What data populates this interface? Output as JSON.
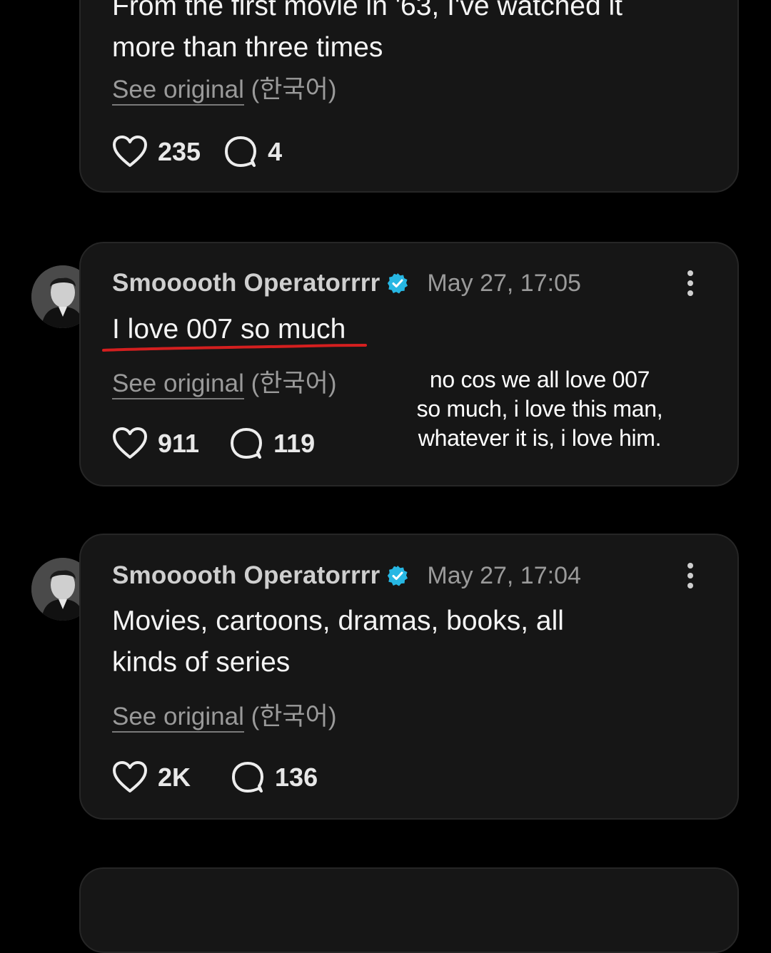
{
  "comments": [
    {
      "text_line_1": "From the first movie in '63, I've watched it",
      "text_line_2": "more than three times",
      "see_original_link": "See original",
      "see_original_lang": "(한국어)",
      "likes": "235",
      "replies": "4"
    },
    {
      "author": "Smooooth Operatorrrr",
      "timestamp": "May 27, 17:05",
      "text": "I love 007 so much",
      "see_original_link": "See original",
      "see_original_lang": "(한국어)",
      "likes": "911",
      "replies": "119"
    },
    {
      "author": "Smooooth Operatorrrr",
      "timestamp": "May 27, 17:04",
      "text_line_1": "Movies, cartoons, dramas, books, all",
      "text_line_2": "kinds of series",
      "see_original_link": "See original",
      "see_original_lang": "(한국어)",
      "likes": "2K",
      "replies": "136"
    }
  ],
  "overlay_caption": {
    "line_1": "no cos we all love 007",
    "line_2": "so much, i love this man,",
    "line_3": "whatever it is, i love him."
  },
  "colors": {
    "background": "#000000",
    "card": "#161616",
    "verified_badge": "#27b7e3",
    "annotation_underline": "#d41f1f"
  },
  "icons": [
    "heart-icon",
    "comment-bubble-icon",
    "verified-badge-icon",
    "more-options-icon",
    "avatar"
  ]
}
